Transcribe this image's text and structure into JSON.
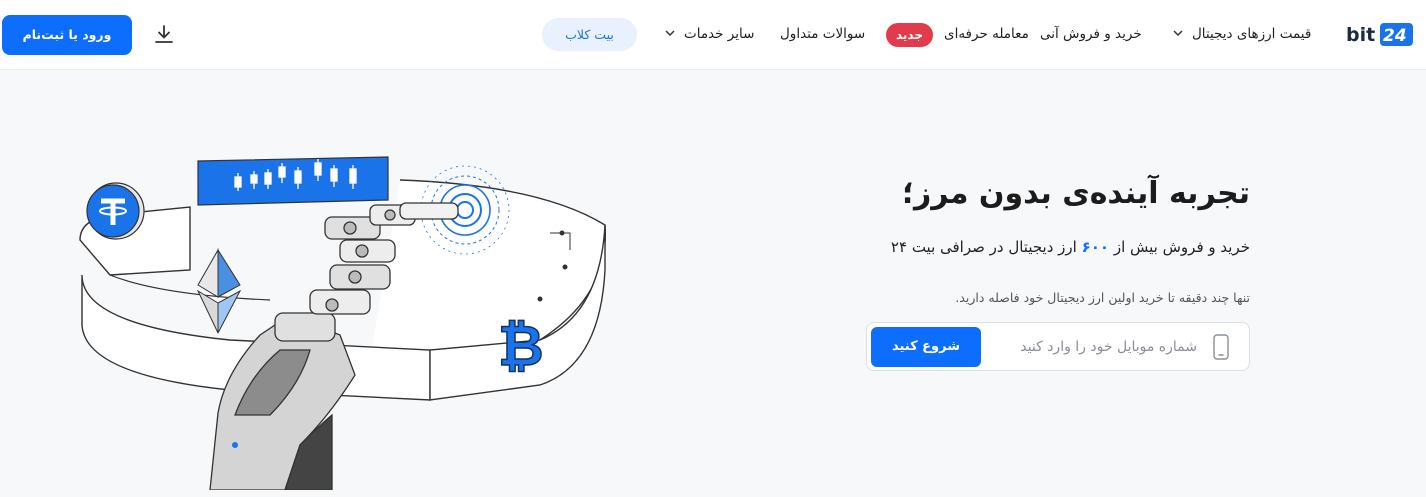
{
  "header": {
    "logo_text": "bit24",
    "nav": [
      {
        "label": "قیمت ارزهای دیجیتال",
        "has_dropdown": true
      },
      {
        "label": "خرید و فروش آنی",
        "has_dropdown": false
      },
      {
        "label": "معامله حرفه‌ای",
        "badge": "جدید"
      },
      {
        "label": "سوالات متداول",
        "has_dropdown": false
      },
      {
        "label": "سایر خدمات",
        "has_dropdown": true
      }
    ],
    "club_button": "بیت کلاب",
    "download_icon": "download-icon",
    "login_button": "ورود یا ثبت‌نام"
  },
  "hero": {
    "title": "تجربه آینده‌ی بدون مرز؛",
    "subtitle_before": "خرید و فروش بیش از",
    "subtitle_number": "۶۰۰",
    "subtitle_after": "ارز دیجیتال در صرافی بیت ۲۴",
    "note": "تنها چند دقیقه تا خرید اولین ارز دیجیتال خود فاصله دارید.",
    "phone_placeholder": "شماره موبایل خود را وارد کنید",
    "start_button": "شروع کنید"
  },
  "colors": {
    "accent": "#0d6efd",
    "badge": "#e23b4c",
    "club_bg": "#e8f1fd"
  }
}
